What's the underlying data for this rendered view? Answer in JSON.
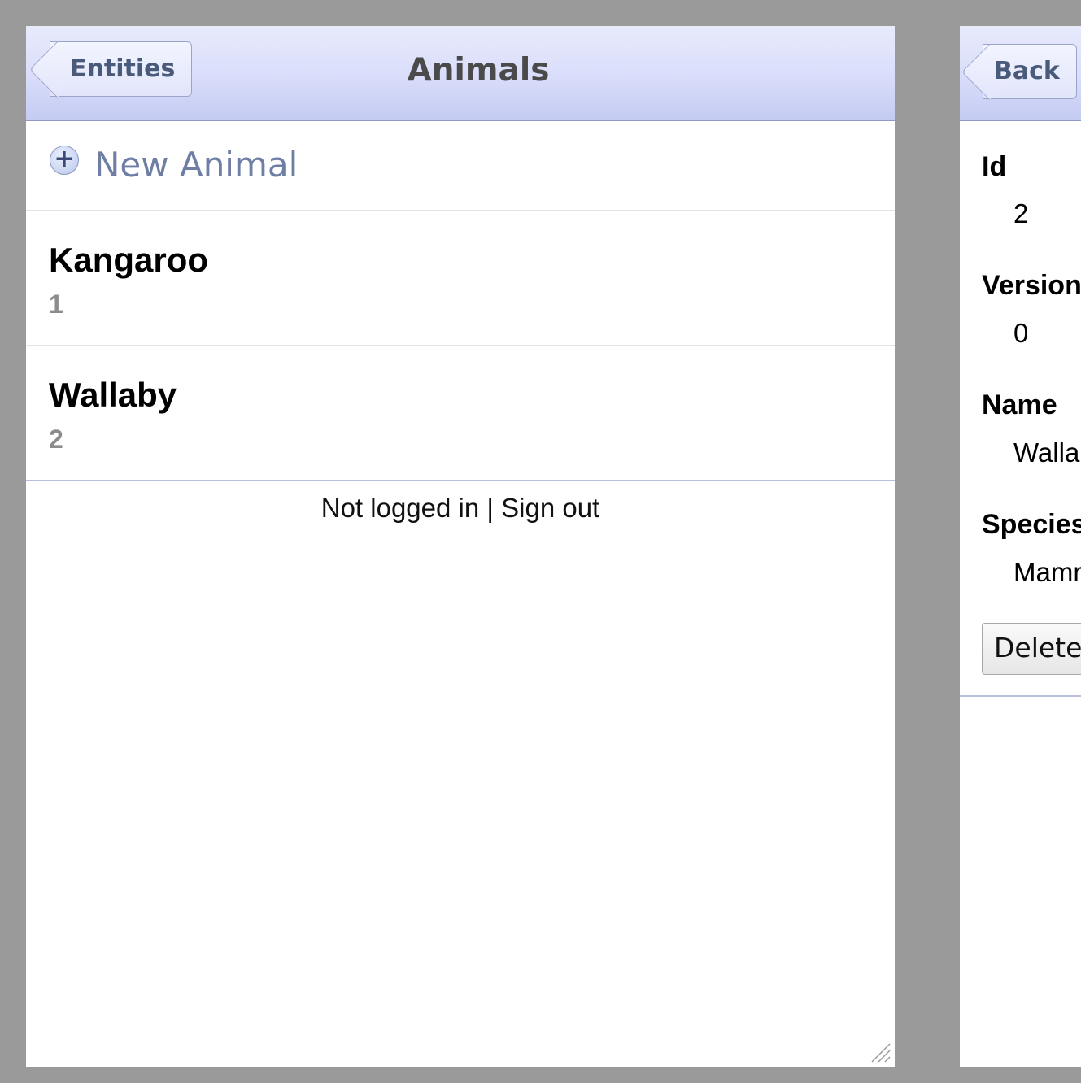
{
  "list_panel": {
    "back_label": "Entities",
    "title": "Animals",
    "new_label": "New Animal",
    "items": [
      {
        "title": "Kangaroo",
        "subtitle": "1"
      },
      {
        "title": "Wallaby",
        "subtitle": "2"
      }
    ],
    "footer": "Not logged in | Sign out"
  },
  "detail_panel": {
    "back_label": "Back",
    "fields": [
      {
        "label": "Id",
        "value": "2"
      },
      {
        "label": "Version",
        "value": "0"
      },
      {
        "label": "Name",
        "value": "Wallaby"
      },
      {
        "label": "Species",
        "value": "Mammal"
      }
    ],
    "delete_label": "Delete"
  },
  "colors": {
    "background": "#9a9a9a",
    "nav_gradient_top": "#e8eafc",
    "nav_gradient_bottom": "#c4cbf3",
    "link_text": "#6f7ea5",
    "subtitle_text": "#8c8c8c"
  },
  "icons": {
    "new_item": "plus-circle-icon",
    "resize": "resize-grip-icon"
  }
}
